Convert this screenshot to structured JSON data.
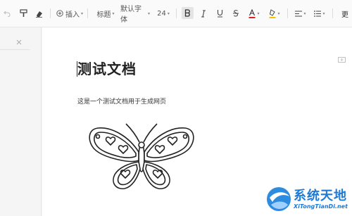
{
  "toolbar": {
    "insert_label": "插入",
    "style_label": "标题",
    "font_label": "默认字体",
    "size_label": "24",
    "font_color": "#e02020",
    "highlight_color": "#f2c200",
    "icons": [
      "undo-icon",
      "format-painter-icon",
      "eraser-icon",
      "add-circle-icon",
      "bold-icon",
      "italic-icon",
      "underline-icon",
      "strikethrough-icon",
      "font-color-icon",
      "highlight-icon",
      "align-icon",
      "list-icon"
    ],
    "more_label": "更"
  },
  "document": {
    "title": "测试文档",
    "paragraph": "这是一个测试文档用于生成网页"
  },
  "watermark": {
    "name": "系统天地",
    "url": "XiTongTianDi.net"
  }
}
